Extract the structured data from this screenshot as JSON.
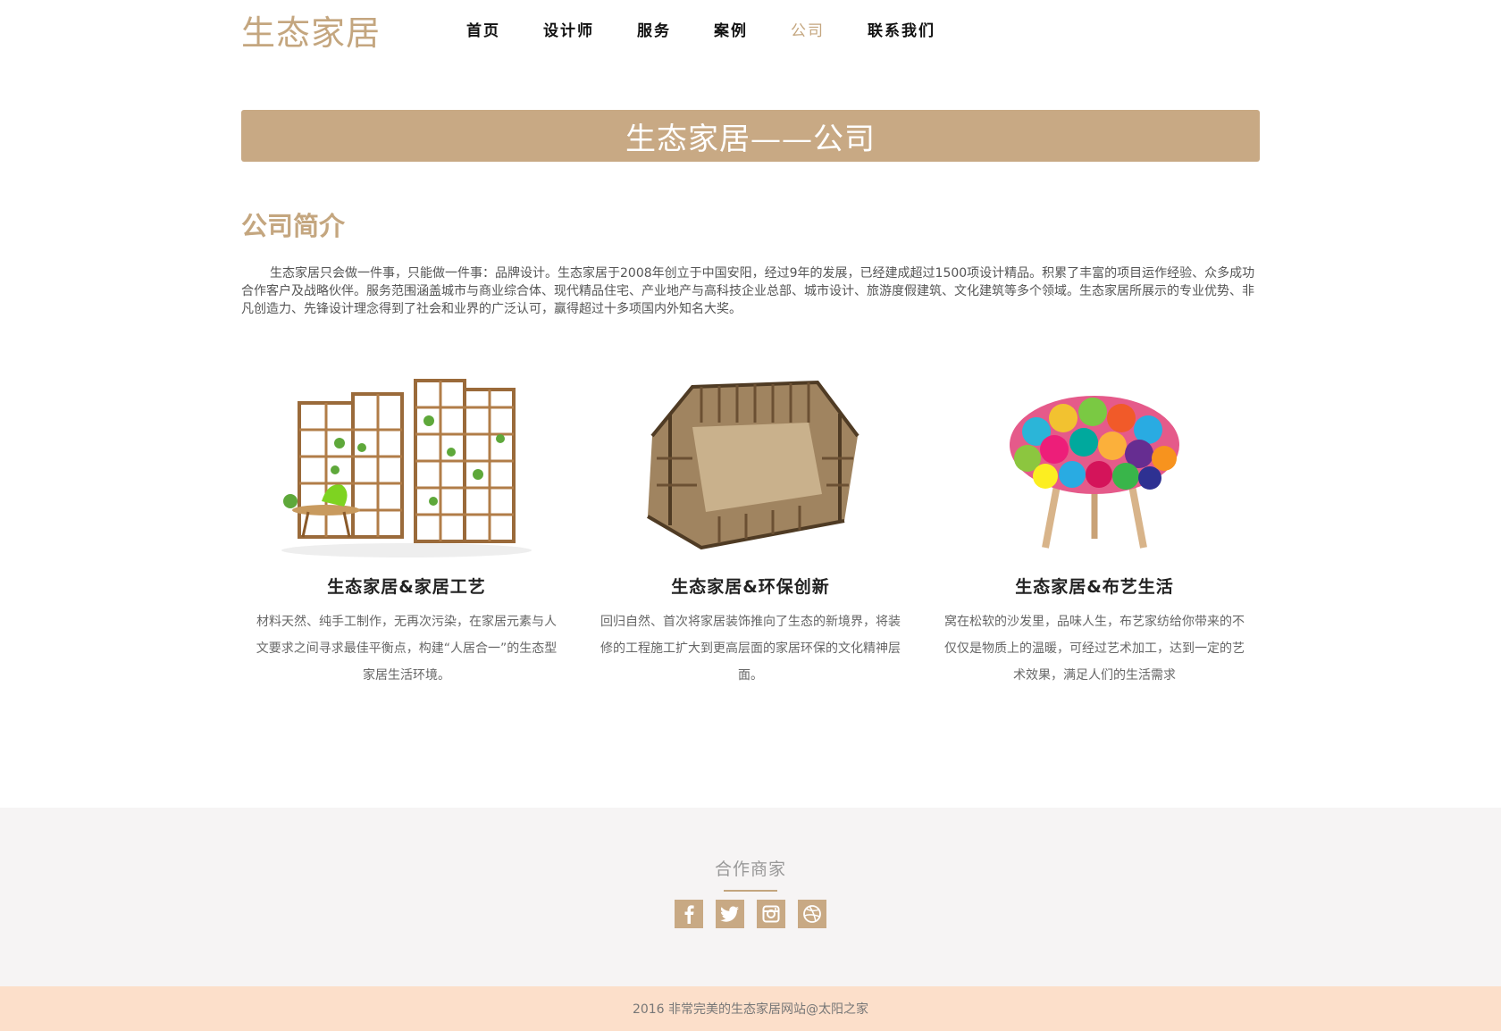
{
  "header": {
    "logo": "生态家居",
    "nav": [
      {
        "label": "首页"
      },
      {
        "label": "设计师"
      },
      {
        "label": "服务"
      },
      {
        "label": "案例"
      },
      {
        "label": "公司",
        "active": true
      },
      {
        "label": "联系我们"
      }
    ]
  },
  "banner": {
    "title": "生态家居——公司"
  },
  "intro": {
    "title": "公司简介",
    "text": "生态家居只会做一件事，只能做一件事：品牌设计。生态家居于2008年创立于中国安阳，经过9年的发展，已经建成超过1500项设计精品。积累了丰富的项目运作经验、众多成功合作客户及战略伙伴。服务范围涵盖城市与商业综合体、现代精品住宅、产业地产与高科技企业总部、城市设计、旅游度假建筑、文化建筑等多个领域。生态家居所展示的专业优势、非凡创造力、先锋设计理念得到了社会和业界的广泛认可，赢得超过十多项国内外知名大奖。"
  },
  "features": [
    {
      "title": "生态家居&家居工艺",
      "desc": "材料天然、纯手工制作，无再次污染，在家居元素与人文要求之间寻求最佳平衡点，构建“人居合一”的生态型家居生活环境。",
      "image": "wooden-screen-shelf-image"
    },
    {
      "title": "生态家居&环保创新",
      "desc": "回归自然、首次将家居装饰推向了生态的新境界，将装修的工程施工扩大到更高层面的家居环保的文化精神层面。",
      "image": "cardboard-armchair-image"
    },
    {
      "title": "生态家居&布艺生活",
      "desc": "窝在松软的沙发里，品味人生，布艺家纺给你带来的不仅仅是物质上的温暖，可经过艺术加工，达到一定的艺术效果，满足人们的生活需求",
      "image": "colorful-fabric-stool-image"
    }
  ],
  "partners": {
    "title": "合作商家",
    "icons": [
      "facebook-icon",
      "twitter-icon",
      "instagram-icon",
      "dribbble-icon"
    ]
  },
  "footer": {
    "text": "2016 非常完美的生态家居网站@太阳之家"
  },
  "colors": {
    "accent": "#c4a67f",
    "banner": "#c8a984",
    "partners_bg": "#f6f4f4",
    "footer_bg": "#fcdfca"
  }
}
